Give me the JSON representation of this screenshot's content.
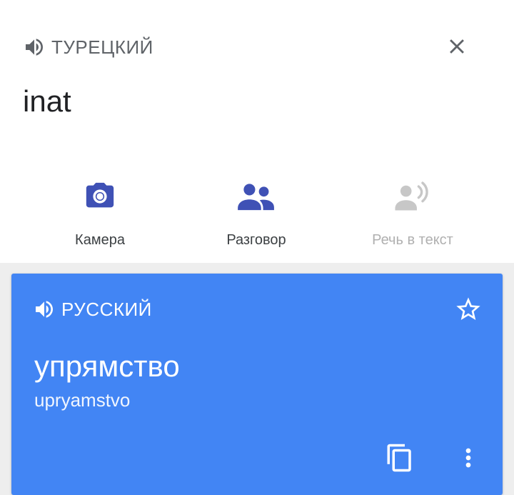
{
  "source": {
    "language": "ТУРЕЦКИЙ",
    "text": "inat"
  },
  "tools": [
    {
      "label": "Камера",
      "icon": "camera-icon",
      "enabled": true
    },
    {
      "label": "Разговор",
      "icon": "conversation-icon",
      "enabled": true
    },
    {
      "label": "Речь в текст",
      "icon": "transcribe-icon",
      "enabled": false
    }
  ],
  "result": {
    "language": "РУССКИЙ",
    "translation": "упрямство",
    "transliteration": "upryamstvo"
  },
  "colors": {
    "accent": "#3f51b5",
    "card": "#4285f4",
    "disabled": "#c7c7c7",
    "icon_gray": "#5f6368"
  }
}
